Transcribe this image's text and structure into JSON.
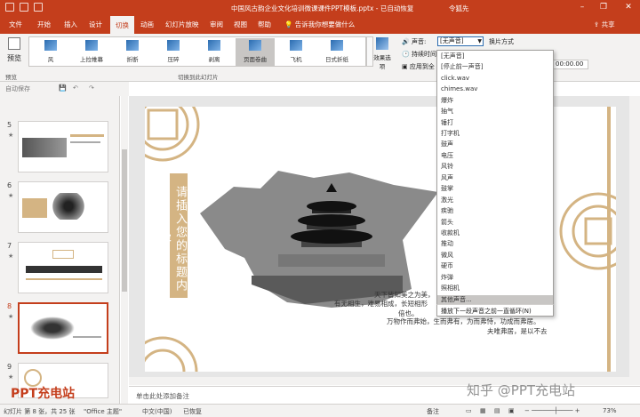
{
  "titlebar": {
    "title": "中国风古韵企业文化培训微课课件PPT模板.pptx  -  已自动恢复",
    "user": "令狐先",
    "minimize": "–",
    "restore": "❐",
    "close": "✕"
  },
  "tabs": [
    "文件",
    "开始",
    "插入",
    "设计",
    "切换",
    "动画",
    "幻灯片放映",
    "审阅",
    "视图",
    "帮助"
  ],
  "active_tab": "切换",
  "search_hint": "告诉我你想要做什么",
  "share": "共享",
  "ribbon": {
    "preview": "预览",
    "effects": [
      "风",
      "上拉帷幕",
      "折断",
      "压碎",
      "剥离",
      "页面卷曲",
      "飞机",
      "日式折纸"
    ],
    "active_effect": "页面卷曲",
    "effect_options": "效果选项",
    "group_preview": "预览",
    "group_switch": "切换到此幻灯片",
    "sound_label": "声音:",
    "sound_value": "[无声音]",
    "switch_mode": "换片方式",
    "duration_label": "持续时间",
    "apply_all": "应用到全",
    "time_value": "00:00.00"
  },
  "sound_dropdown": [
    "[无声音]",
    "[停止前一声音]",
    "click.wav",
    "chimes.wav",
    "爆炸",
    "抽气",
    "锤打",
    "打字机",
    "鼓声",
    "电压",
    "风铃",
    "风声",
    "鼓掌",
    "激光",
    "疾驰",
    "箭头",
    "收款机",
    "推动",
    "微风",
    "硬币",
    "炸弹",
    "照相机",
    "其他声音..."
  ],
  "dropdown_highlight": "其他声音...",
  "loop_option": "播放下一段声音之前一直循环(N)",
  "toolbar2": {
    "label": "自动保存"
  },
  "thumbnails": [
    {
      "num": "5",
      "star": "★"
    },
    {
      "num": "6",
      "star": "★"
    },
    {
      "num": "7",
      "star": "★"
    },
    {
      "num": "8",
      "star": "★"
    },
    {
      "num": "9",
      "star": "★"
    }
  ],
  "slide": {
    "vertical_title": "请插入您的标题内容",
    "lines": [
      "天下皆知美之为美，",
      "有无相生，难易相成，长短相形",
      "倍也。",
      "万物作而弗始，生而弗有，为而弗恃，功成而弗居。",
      "夫唯弗居，是以不去"
    ]
  },
  "notes_placeholder": "单击此处添加备注",
  "status": {
    "slide_info": "幻灯片 第 8 张，共 25 张",
    "theme": "\"Office 主题\"",
    "language": "中文(中国)",
    "recovered": "已恢复",
    "notes": "备注",
    "zoom": "73%"
  },
  "watermark": "知乎 @PPT充电站",
  "logo_watermark": "PPT充电站"
}
